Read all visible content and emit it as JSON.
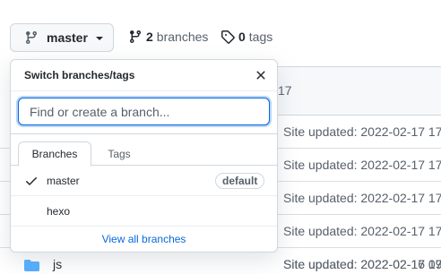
{
  "toolbar": {
    "branch_button_label": "master",
    "branches_count": "2",
    "branches_label": "branches",
    "tags_count": "0",
    "tags_label": "tags"
  },
  "file_list": {
    "header_tail": "17",
    "rows": [
      {
        "message": "Site updated: 2022-02-17 17"
      },
      {
        "message": "Site updated: 2022-02-17 17"
      },
      {
        "message": "Site updated: 2022-02-17 17"
      },
      {
        "message": "Site updated: 2022-02-17 17"
      },
      {
        "message": "Site updated: 2022-02-17 17"
      },
      {
        "name": "js",
        "message": "Site updated: 2022-02-16 09"
      }
    ]
  },
  "dropdown": {
    "title": "Switch branches/tags",
    "search_placeholder": "Find or create a branch...",
    "tabs": [
      {
        "label": "Branches",
        "active": true
      },
      {
        "label": "Tags",
        "active": false
      }
    ],
    "branches": [
      {
        "name": "master",
        "selected": true,
        "badge": "default"
      },
      {
        "name": "hexo",
        "selected": false,
        "badge": ""
      }
    ],
    "view_all_label": "View all branches"
  },
  "colors": {
    "accent": "#0969da",
    "folder": "#54aeff",
    "muted": "#57606a",
    "border": "#d0d7de"
  },
  "icons": [
    "git-branch-icon",
    "chevron-down-icon",
    "tag-icon",
    "close-icon",
    "check-icon",
    "folder-icon"
  ]
}
